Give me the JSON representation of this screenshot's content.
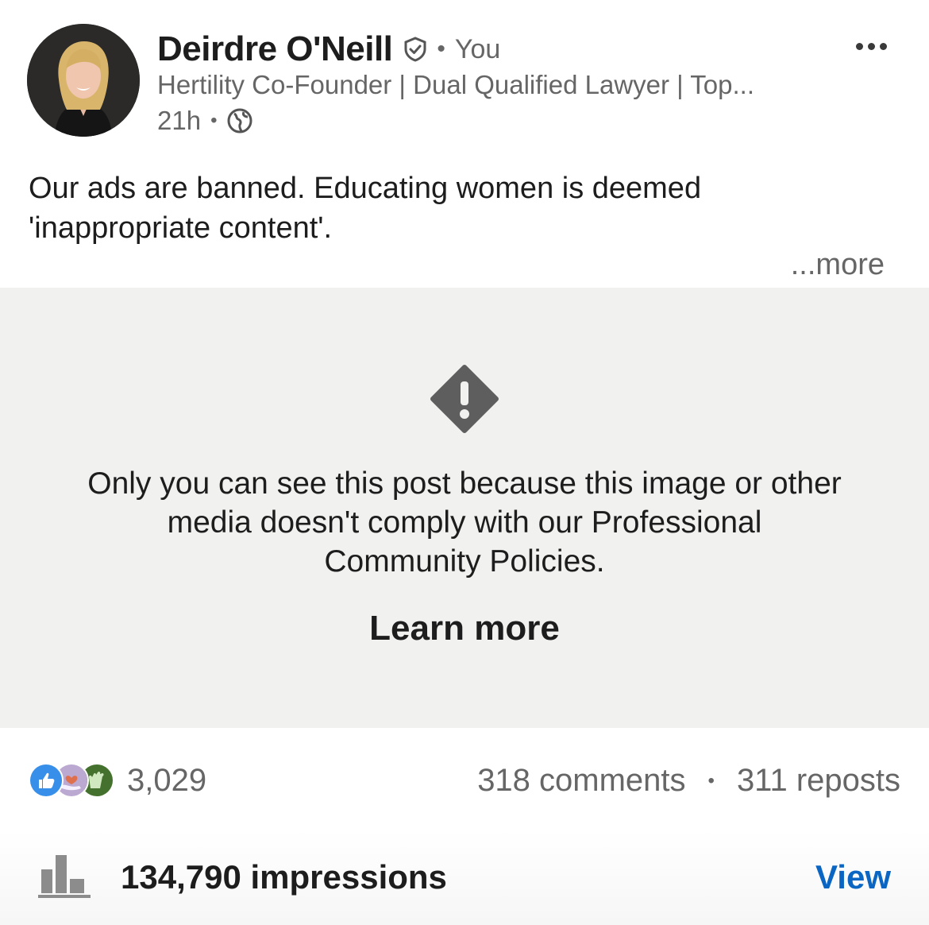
{
  "post": {
    "author": {
      "name": "Deirdre O'Neill",
      "relation": "You",
      "separator": "•",
      "headline": "Hertility Co-Founder | Dual Qualified Lawyer | Top...",
      "time": "21h",
      "time_separator": "•",
      "avatar_icon": "avatar-photo",
      "verified_icon": "verified-shield-icon",
      "visibility_icon": "globe-icon"
    },
    "body": {
      "line1": "Our ads are banned. Educating women is deemed",
      "line2": "'inappropriate content'.",
      "see_more": "...more"
    },
    "notice": {
      "icon": "warning-icon",
      "text_line1": "Only you can see this post because this image or other",
      "text_line2": "media doesn't comply with our Professional",
      "text_line3": "Community Policies.",
      "learn_more": "Learn more"
    },
    "social": {
      "reaction_icons": [
        "like-icon",
        "support-icon",
        "celebrate-icon"
      ],
      "reaction_count": "3,029",
      "comments": "318 comments",
      "separator": "•",
      "reposts": "311 reposts"
    },
    "analytics": {
      "icon": "bar-chart-icon",
      "impressions": "134,790 impressions",
      "view_label": "View"
    }
  },
  "colors": {
    "link_blue": "#0a66c2",
    "notice_background": "#f1f1ef",
    "secondary_text": "#666666"
  }
}
